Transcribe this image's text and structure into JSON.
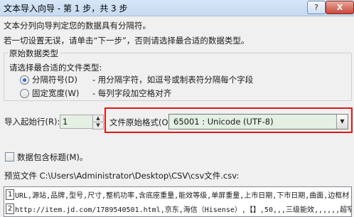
{
  "window": {
    "title": "文本导入向导 - 第 1 步，共 3 步",
    "help_label": "?",
    "close_label": "X"
  },
  "intro": {
    "line1": "文本分列向导判定您的数据具有分隔符。",
    "line2": "若一切设置无误，请单击“下一步”，否则请选择最合适的数据类型。"
  },
  "original_type": {
    "legend": "原始数据类型",
    "prompt": "请选择最合适的文件类型:",
    "options": [
      {
        "label": "分隔符号(D)",
        "desc": "- 用分隔字符，如逗号或制表符分隔每个字段",
        "selected": true
      },
      {
        "label": "固定宽度(W)",
        "desc": "- 每列字段加空格对齐",
        "selected": false
      }
    ]
  },
  "start_row": {
    "label": "导入起始行(R):",
    "value": "1"
  },
  "file_origin": {
    "label": "文件原始格式(O):",
    "value": "65001 : Unicode (UTF-8)"
  },
  "header_checkbox": {
    "label": "数据包含标题(M)。",
    "checked": false
  },
  "preview": {
    "label": "预览文件 C:\\Users\\Administrator\\Desktop\\CSV\\csv文件.csv:",
    "lines": [
      {
        "num": "1",
        "text": "URL,源站,品牌,型号,尺寸,整机功率,含底座重量,能效等级,单屏重量,上市日期,下市日期,曲面,边框材"
      },
      {
        "num": "2",
        "text": "http://item.jd.com/1789540501.html,京东,海信（Hisense）,【】,50,,,三级能效,,,,,,超窄"
      }
    ]
  },
  "colors": {
    "accent": "#2f6bd1",
    "field_bg": "#e3f0e3",
    "highlight": "#e01616"
  }
}
